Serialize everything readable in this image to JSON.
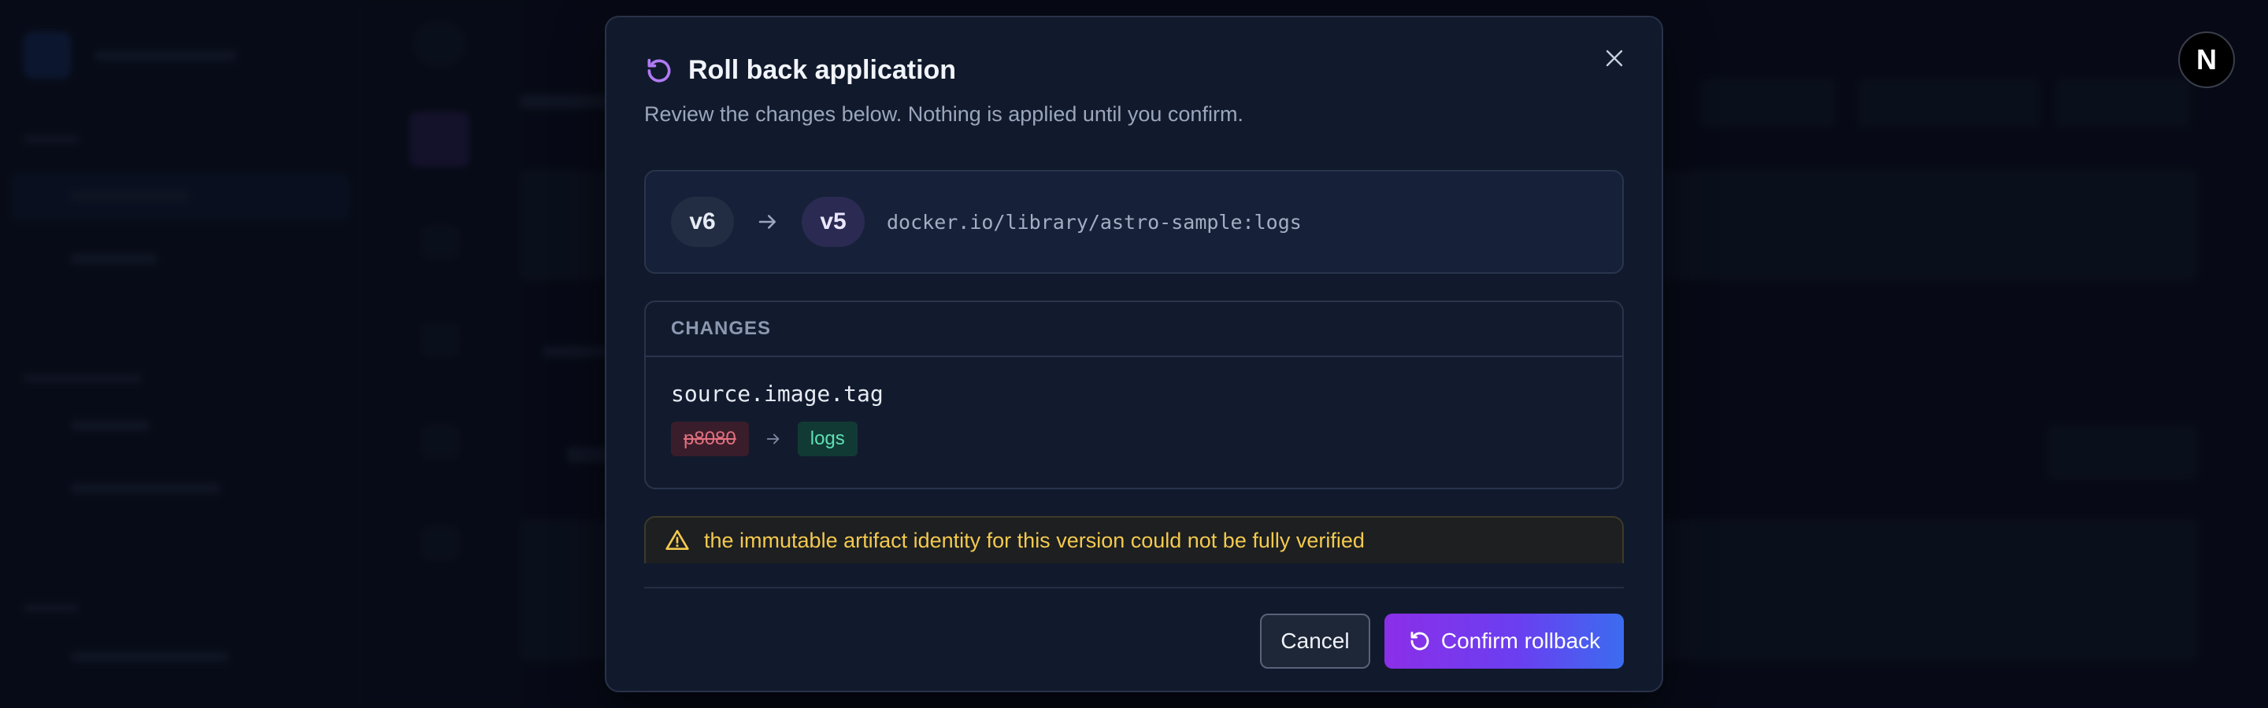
{
  "colors": {
    "accent_purple": "#8b2fe8",
    "accent_blue": "#3b6cf0",
    "warning": "#f3c94f",
    "removed": "#e0707f",
    "added": "#5fe0b4"
  },
  "avatar": {
    "initial": "N"
  },
  "dialog": {
    "title": "Roll back application",
    "subtitle": "Review the changes below. Nothing is applied until you confirm.",
    "title_icon": "rollback-icon",
    "close_icon": "close-icon"
  },
  "versions": {
    "from": "v6",
    "to": "v5",
    "image": "docker.io/library/astro-sample:logs"
  },
  "changes": {
    "heading": "CHANGES",
    "items": [
      {
        "key": "source.image.tag",
        "old_value": "p8080",
        "new_value": "logs"
      }
    ]
  },
  "warning": {
    "icon": "warning-triangle-icon",
    "text": "the immutable artifact identity for this version could not be fully verified"
  },
  "actions": {
    "cancel_label": "Cancel",
    "confirm_label": "Confirm rollback"
  }
}
